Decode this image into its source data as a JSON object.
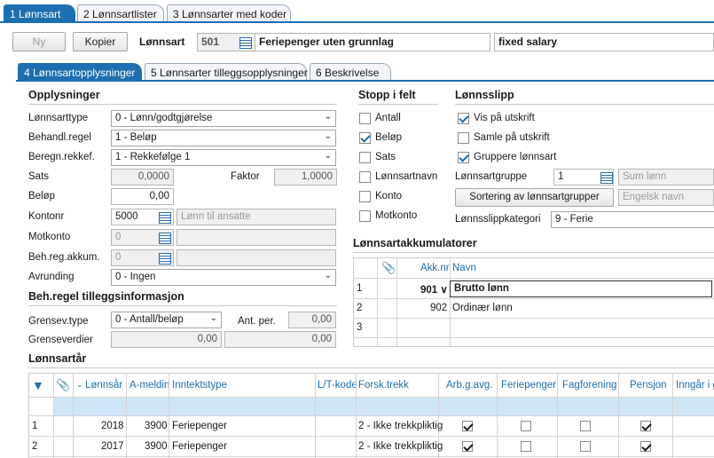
{
  "top_tabs": [
    "1 Lønnsart",
    "2 Lønnsartlister",
    "3 Lønnsarter med koder"
  ],
  "toolbar": {
    "ny": "Ny",
    "kopier": "Kopier",
    "lonnsart_label": "Lønnsart",
    "number": "501",
    "name": "Feriepenger uten grunnlag",
    "english": "fixed salary"
  },
  "sub_tabs": [
    "4 Lønnsartopplysninger",
    "5 Lønnsarter tilleggsopplysninger",
    "6 Beskrivelse"
  ],
  "opplysninger": {
    "title": "Opplysninger",
    "lonnsarttype_label": "Lønnsarttype",
    "lonnsarttype": "0 - Lønn/godtgjørelse",
    "behandl_label": "Behandl.regel",
    "behandl": "1 - Beløp",
    "beregn_label": "Beregn.rekkef.",
    "beregn": "1 - Rekkefølge 1",
    "sats_label": "Sats",
    "sats": "0,0000",
    "faktor_label": "Faktor",
    "faktor": "1,0000",
    "belop_label": "Beløp",
    "belop": "0,00",
    "kontonr_label": "Kontonr",
    "kontonr": "5000",
    "kontonr_name": "Lønn til ansatte",
    "motkonto_label": "Motkonto",
    "motkonto": "0",
    "behreg_label": "Beh.reg.akkum.",
    "behreg": "0",
    "avrunding_label": "Avrunding",
    "avrunding": "0 - Ingen"
  },
  "tillegg": {
    "title": "Beh.regel tilleggsinformasjon",
    "grensev_label": "Grensev.type",
    "grensev": "0 - Antall/beløp",
    "antper_label": "Ant. per.",
    "antper": "0,00",
    "grenseverdier_label": "Grenseverdier",
    "gv1": "0,00",
    "gv2": "0,00"
  },
  "stopp": {
    "title": "Stopp i felt",
    "items": [
      {
        "label": "Antall",
        "checked": false
      },
      {
        "label": "Beløp",
        "checked": true
      },
      {
        "label": "Sats",
        "checked": false
      },
      {
        "label": "Lønnsartnavn",
        "checked": false
      },
      {
        "label": "Konto",
        "checked": false
      },
      {
        "label": "Motkonto",
        "checked": false
      }
    ]
  },
  "lonnsslipp": {
    "title": "Lønnsslipp",
    "vis": "Vis på utskrift",
    "samle": "Samle på utskrift",
    "gruppere": "Gruppere lønnsart",
    "gruppe_label": "Lønnsartgruppe",
    "gruppe": "1",
    "gruppe_name": "Sum lønn",
    "sortering": "Sortering av lønnsartgrupper",
    "engelsk": "Engelsk navn",
    "kategori_label": "Lønnsslippkategori",
    "kategori": "9 - Ferie"
  },
  "akkumulatorer": {
    "title": "Lønnsartakkumulatorer",
    "col_akk": "Akk.nr",
    "col_navn": "Navn",
    "rows": [
      {
        "n": "1",
        "akk": "901",
        "navn": "Brutto lønn"
      },
      {
        "n": "2",
        "akk": "902",
        "navn": "Ordinær lønn"
      },
      {
        "n": "3",
        "akk": "",
        "navn": ""
      }
    ]
  },
  "lonnsartar": {
    "title": "Lønnsartår",
    "headers": [
      "Lønnsår",
      "A-meldin",
      "Inntektstype",
      "L/T-kode",
      "Forsk.trekk",
      "Arb.g.avg.",
      "Feriepenger",
      "Fagforening",
      "Pensjon",
      "Inngår i g"
    ],
    "rows": [
      {
        "n": "1",
        "year": "2018",
        "ameld": "3900",
        "type": "Feriepenger",
        "forsk": "2 - Ikke trekkpliktig",
        "arbg": true,
        "ferie": false,
        "fag": false,
        "pensjon": true
      },
      {
        "n": "2",
        "year": "2017",
        "ameld": "3900",
        "type": "Feriepenger",
        "forsk": "2 - Ikke trekkpliktig",
        "arbg": true,
        "ferie": false,
        "fag": false,
        "pensjon": true
      }
    ]
  }
}
